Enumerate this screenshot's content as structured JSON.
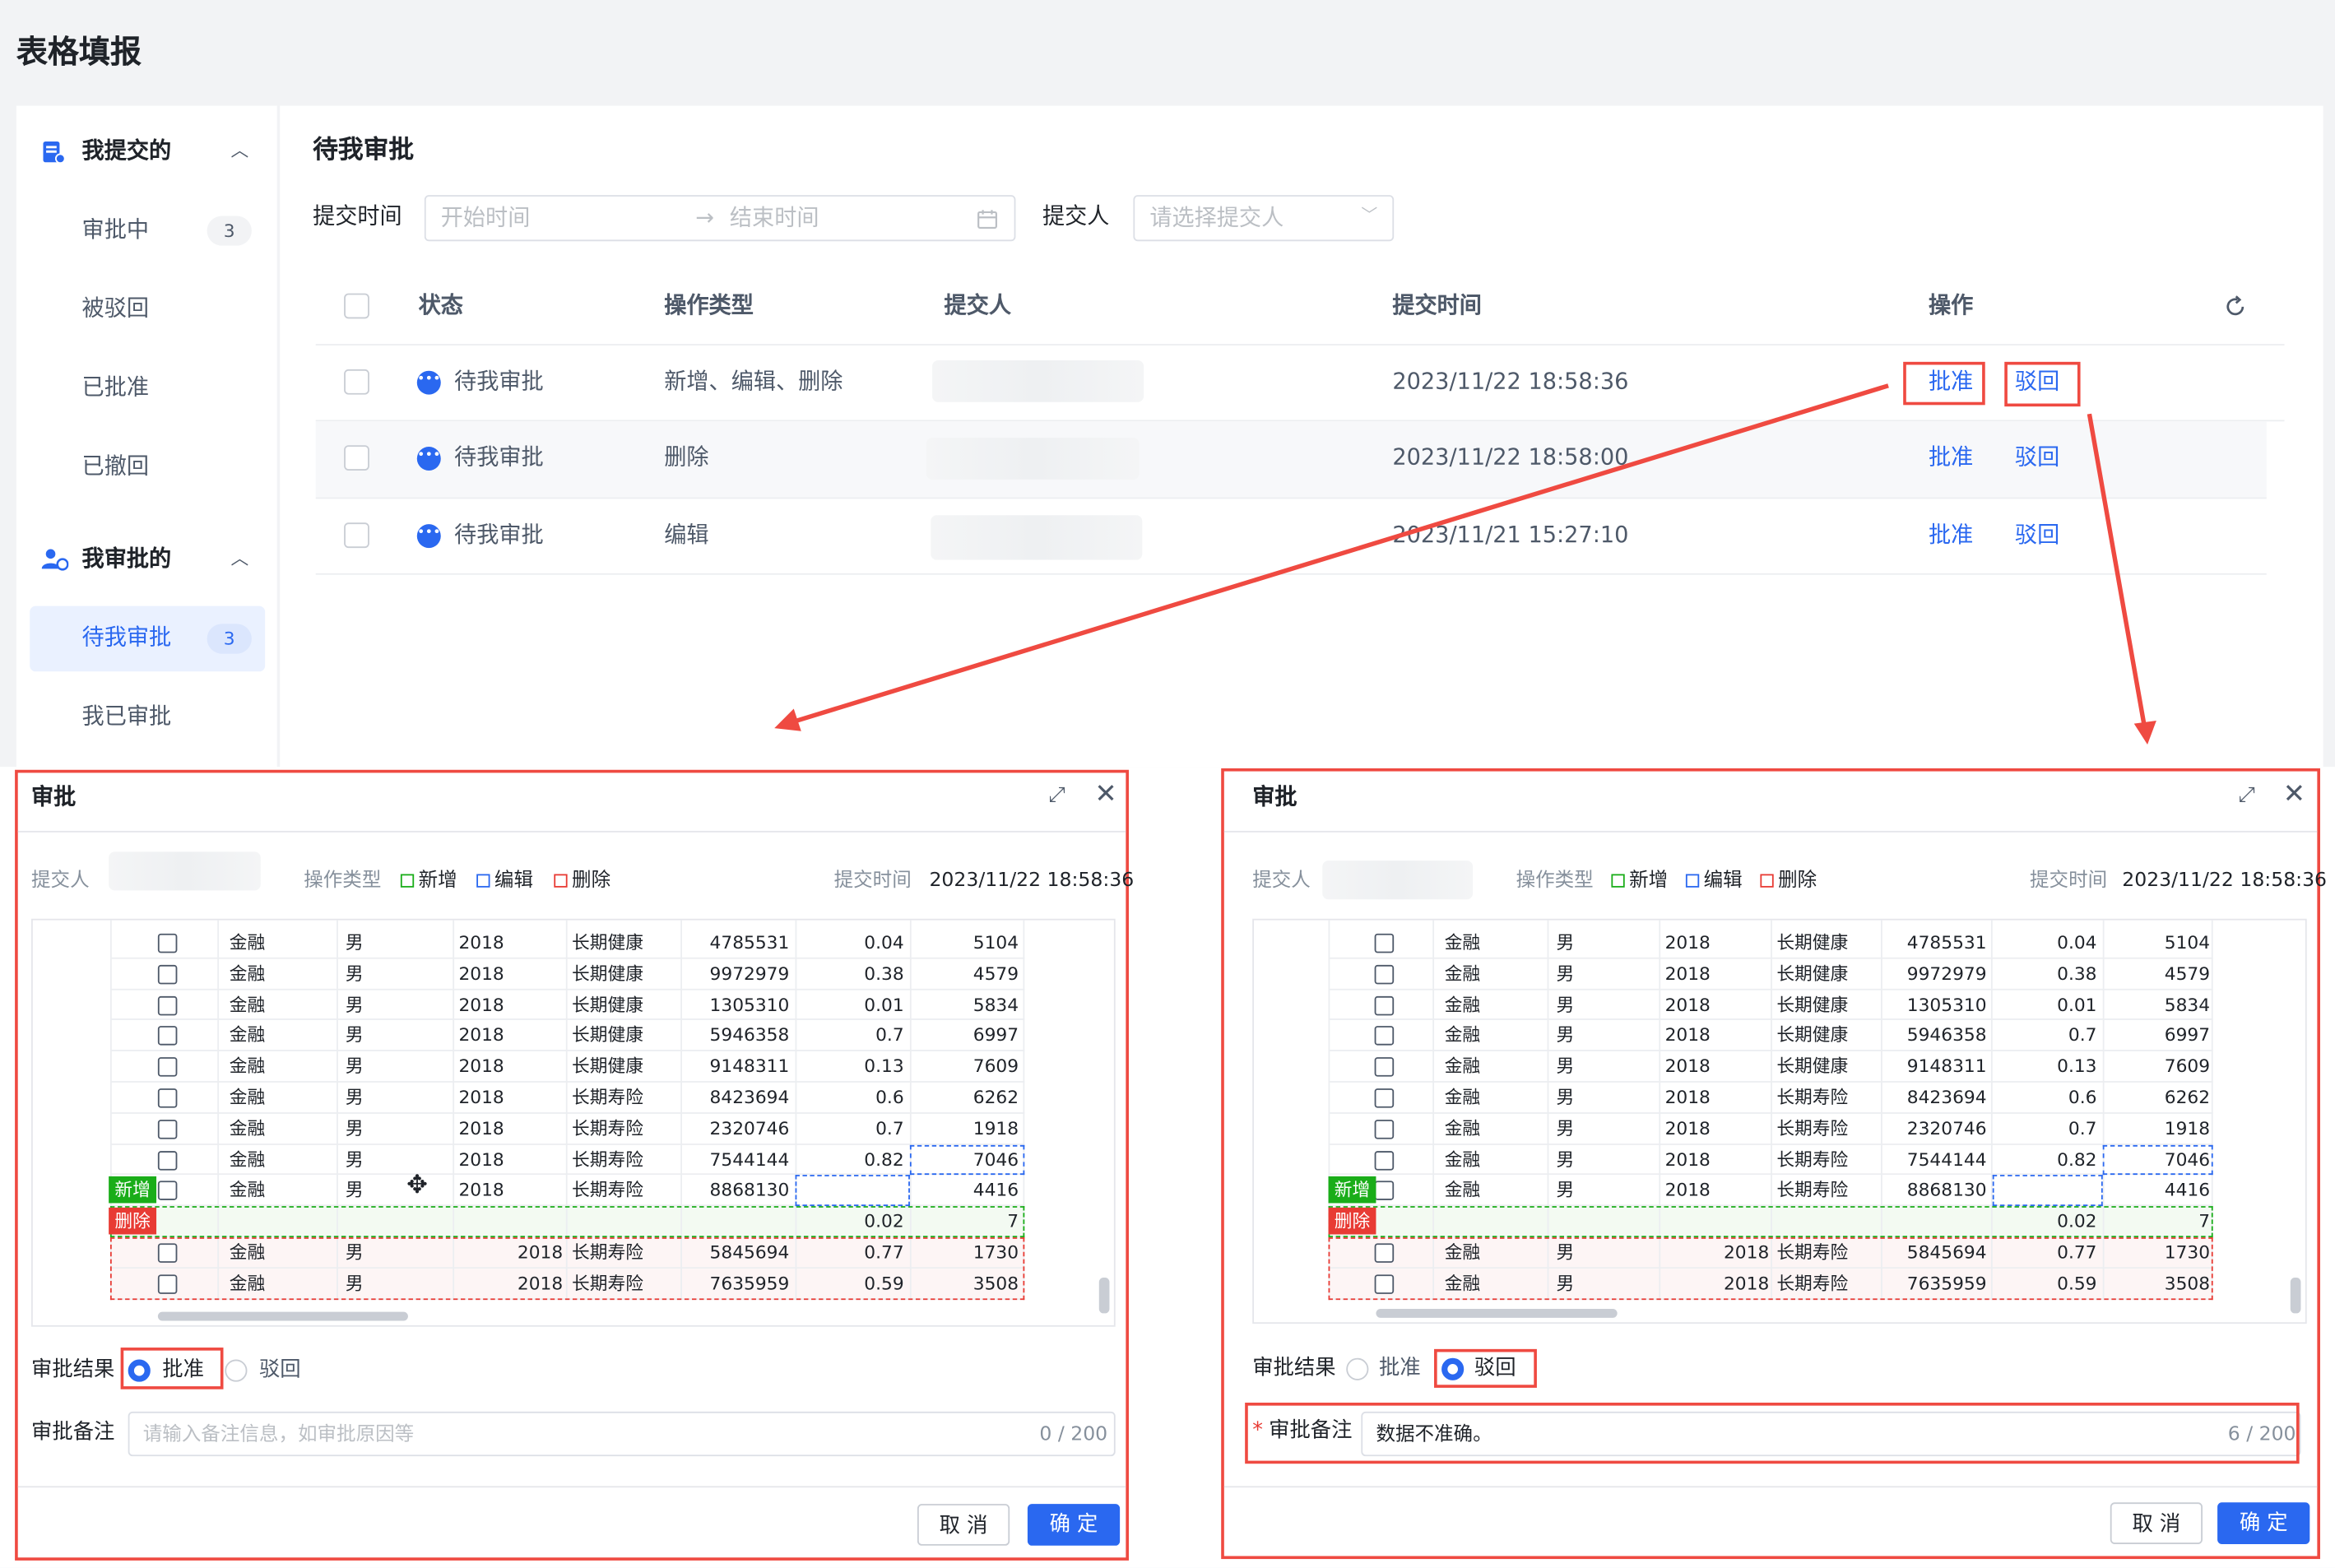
{
  "page_title": "表格填报",
  "sidebar": {
    "groups": [
      {
        "label": "我提交的",
        "items": [
          {
            "label": "审批中",
            "badge": "3"
          },
          {
            "label": "被驳回"
          },
          {
            "label": "已批准"
          },
          {
            "label": "已撤回"
          }
        ]
      },
      {
        "label": "我审批的",
        "items": [
          {
            "label": "待我审批",
            "badge": "3"
          },
          {
            "label": "我已审批"
          }
        ]
      }
    ]
  },
  "main": {
    "title": "待我审批",
    "filters": {
      "time_label": "提交时间",
      "start_placeholder": "开始时间",
      "range_arrow": "→",
      "end_placeholder": "结束时间",
      "submitter_label": "提交人",
      "submitter_placeholder": "请选择提交人"
    },
    "table": {
      "headers": [
        "状态",
        "操作类型",
        "提交人",
        "提交时间",
        "操作"
      ],
      "rows": [
        {
          "status": "待我审批",
          "op_type": "新增、编辑、删除",
          "time": "2023/11/22 18:58:36",
          "approve": "批准",
          "reject": "驳回"
        },
        {
          "status": "待我审批",
          "op_type": "删除",
          "time": "2023/11/22 18:58:00",
          "approve": "批准",
          "reject": "驳回"
        },
        {
          "status": "待我审批",
          "op_type": "编辑",
          "time": "2023/11/21 15:27:10",
          "approve": "批准",
          "reject": "驳回"
        }
      ]
    }
  },
  "dialog_common": {
    "title": "审批",
    "submitter_label": "提交人",
    "op_type_label": "操作类型",
    "legend": {
      "add": "新增",
      "edit": "编辑",
      "delete": "删除"
    },
    "time_label": "提交时间",
    "time_value": "2023/11/22 18:58:36",
    "result_label": "审批结果",
    "approve_option": "批准",
    "reject_option": "驳回",
    "remark_label": "审批备注",
    "cancel": "取 消",
    "confirm": "确 定",
    "tag_add": "新增",
    "tag_delete": "删除"
  },
  "dialog_left": {
    "remark_placeholder": "请输入备注信息，如审批原因等",
    "remark_value": "",
    "counter": "0 / 200",
    "selected": "approve"
  },
  "dialog_right": {
    "remark_placeholder": "",
    "remark_value": "数据不准确。",
    "counter": "6 / 200",
    "selected": "reject"
  },
  "grid_rows": [
    [
      "金融",
      "男",
      "2018",
      "长期健康",
      "4785531",
      "0.04",
      "5104"
    ],
    [
      "金融",
      "男",
      "2018",
      "长期健康",
      "9972979",
      "0.38",
      "4579"
    ],
    [
      "金融",
      "男",
      "2018",
      "长期健康",
      "1305310",
      "0.01",
      "5834"
    ],
    [
      "金融",
      "男",
      "2018",
      "长期健康",
      "5946358",
      "0.7",
      "6997"
    ],
    [
      "金融",
      "男",
      "2018",
      "长期健康",
      "9148311",
      "0.13",
      "7609"
    ],
    [
      "金融",
      "男",
      "2018",
      "长期寿险",
      "8423694",
      "0.6",
      "6262"
    ],
    [
      "金融",
      "男",
      "2018",
      "长期寿险",
      "2320746",
      "0.7",
      "1918"
    ],
    [
      "金融",
      "男",
      "2018",
      "长期寿险",
      "7544144",
      "0.82",
      "7046"
    ],
    [
      "金融",
      "男",
      "2018",
      "长期寿险",
      "8868130",
      "",
      "4416"
    ],
    [
      "",
      "",
      "",
      "",
      "",
      "0.02",
      "7"
    ],
    [
      "金融",
      "男",
      "2018",
      "长期寿险",
      "5845694",
      "0.77",
      "1730"
    ],
    [
      "金融",
      "男",
      "2018",
      "长期寿险",
      "7635959",
      "0.59",
      "3508"
    ]
  ],
  "colors": {
    "primary": "#2a68f0",
    "annotation_red": "#ef4a41",
    "add_green": "#1aad19",
    "delete_red": "#e83b34"
  }
}
